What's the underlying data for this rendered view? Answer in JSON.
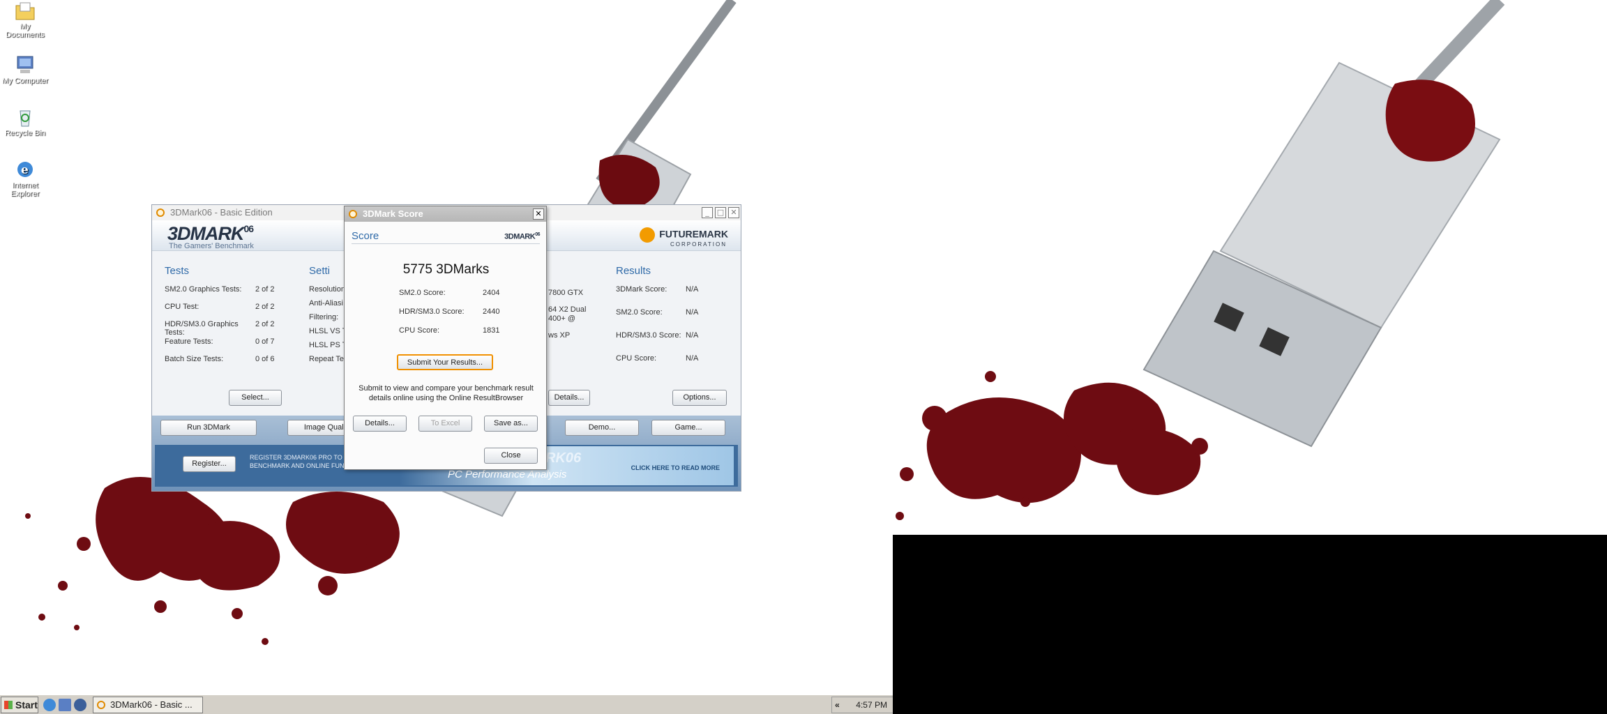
{
  "desktop": {
    "icons": [
      {
        "label": "My Documents",
        "icon": "folder-icon"
      },
      {
        "label": "My Computer",
        "icon": "computer-icon"
      },
      {
        "label": "Recycle Bin",
        "icon": "recycle-bin-icon"
      },
      {
        "label": "Internet Explorer",
        "icon": "ie-icon"
      }
    ]
  },
  "main_window": {
    "title": "3DMark06 - Basic Edition",
    "brand": {
      "logo": "3DMARK",
      "logo_sup": "06",
      "tagline": "The Gamers' Benchmark",
      "company": "FUTUREMARK",
      "company_sub": "CORPORATION"
    },
    "tests": {
      "heading": "Tests",
      "rows": [
        {
          "label": "SM2.0 Graphics Tests:",
          "value": "2 of 2"
        },
        {
          "label": "CPU Test:",
          "value": "2 of 2"
        },
        {
          "label": "HDR/SM3.0 Graphics Tests:",
          "value": "2 of 2"
        },
        {
          "label": "Feature Tests:",
          "value": "0 of 7"
        },
        {
          "label": "Batch Size Tests:",
          "value": "0 of 6"
        }
      ],
      "button": "Select..."
    },
    "settings": {
      "heading": "Setti",
      "rows": [
        "Resolution",
        "Anti-Aliasi",
        "Filtering:",
        "HLSL VS T",
        "HLSL PS T",
        "Repeat Te"
      ]
    },
    "system": {
      "lines": [
        "7800 GTX",
        "64 X2 Dual",
        "400+ @",
        "ws XP"
      ],
      "button": "Details..."
    },
    "results": {
      "heading": "Results",
      "rows": [
        {
          "label": "3DMark Score:",
          "value": "N/A"
        },
        {
          "label": "SM2.0 Score:",
          "value": "N/A"
        },
        {
          "label": "HDR/SM3.0 Score:",
          "value": "N/A"
        },
        {
          "label": "CPU Score:",
          "value": "N/A"
        }
      ],
      "button": "Options..."
    },
    "actions": {
      "run": "Run 3DMark",
      "image_quality": "Image Qualit",
      "demo": "Demo...",
      "game": "Game..."
    },
    "register": {
      "button": "Register...",
      "text_line1": "REGISTER 3DMARK06 PRO TO OBTA",
      "text_line2": "BENCHMARK AND ONLINE FUNCTION",
      "ad_title": "PC Performance Analysis",
      "ad_logo": "RK06",
      "ad_link": "CLICK HERE TO READ MORE"
    }
  },
  "score_dialog": {
    "title": "3DMark Score",
    "heading": "Score",
    "logo": "3DMARK",
    "logo_sup": "06",
    "total": "5775 3DMarks",
    "rows": [
      {
        "label": "SM2.0 Score:",
        "value": "2404"
      },
      {
        "label": "HDR/SM3.0 Score:",
        "value": "2440"
      },
      {
        "label": "CPU Score:",
        "value": "1831"
      }
    ],
    "submit_button": "Submit Your Results...",
    "note": "Submit to view and compare your benchmark result details online using the Online ResultBrowser",
    "details_button": "Details...",
    "excel_button": "To Excel",
    "save_button": "Save as...",
    "close_button": "Close"
  },
  "taskbar": {
    "start": "Start",
    "task_label": "3DMark06 - Basic ...",
    "tray_arrow": "«",
    "clock": "4:57 PM"
  },
  "colors": {
    "accent": "#2f6aa8",
    "blood": "#7a0d12",
    "orange": "#f29b00"
  }
}
